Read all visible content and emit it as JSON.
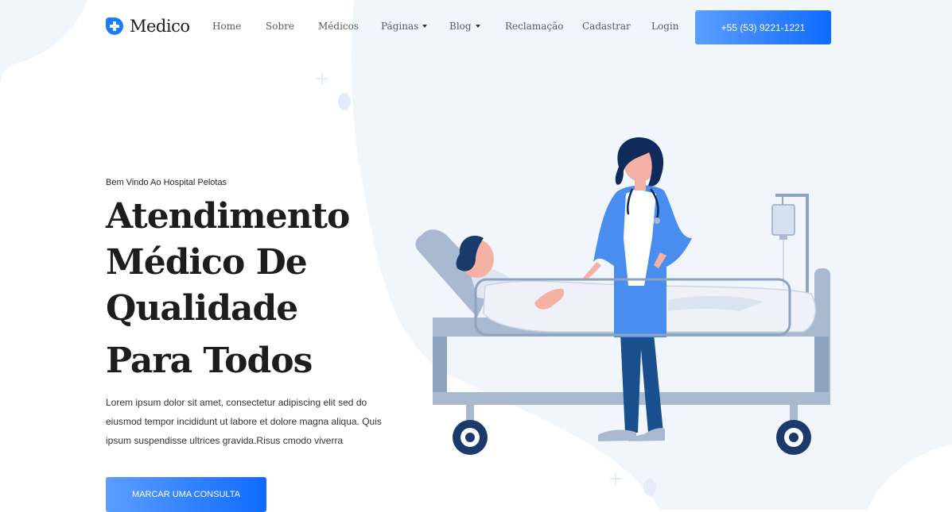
{
  "header": {
    "logo_text": "Medico",
    "nav": [
      {
        "label": "Home"
      },
      {
        "label": "Sobre"
      },
      {
        "label": "Médicos"
      },
      {
        "label": "Páginas"
      },
      {
        "label": "Blog"
      },
      {
        "label": "Reclamação"
      },
      {
        "label": "Cadastrar"
      },
      {
        "label": "Login"
      }
    ],
    "phone_button": "+55 (53) 9221-1221"
  },
  "hero": {
    "eyebrow": "Bem Vindo Ao Hospital Pelotas",
    "headline_lines": [
      "Atendimento",
      "Médico De",
      "Qualidade",
      "Para Todos"
    ],
    "description": "Lorem ipsum dolor sit amet, consectetur adipiscing elit sed do eiusmod tempor incididunt ut labore et dolore magna aliqua. Quis ipsum suspendisse ultrices gravida.Risus cmodo viverra",
    "cta_label": "MARCAR UMA CONSULTA"
  },
  "colors": {
    "accent": "#1b7cff",
    "background_blob": "#f1f6fd",
    "headline": "#1d1d1d"
  },
  "icons": {
    "logo": "medical-cross-icon",
    "dropdown": "caret-down-icon"
  }
}
